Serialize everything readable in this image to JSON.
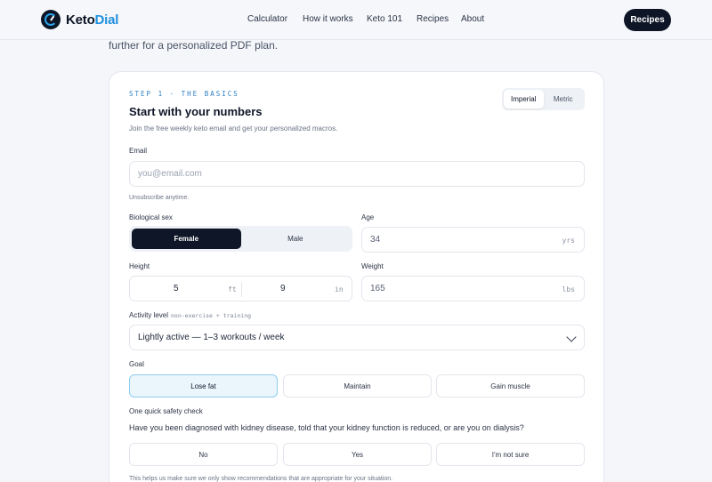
{
  "brand": {
    "name_main": "Keto",
    "name_accent": "Dial"
  },
  "nav": {
    "links": [
      "Calculator",
      "How it works",
      "Keto 101",
      "Recipes",
      "About"
    ],
    "cta": "Recipes"
  },
  "intro": "further for a personalized PDF plan.",
  "step": {
    "eyebrow": "STEP 1 · THE BASICS",
    "title": "Start with your numbers",
    "subtitle": "Join the free weekly keto email and get your personalized macros.",
    "units": [
      "Imperial",
      "Metric"
    ]
  },
  "form": {
    "email": {
      "label": "Email",
      "placeholder": "you@email.com",
      "hint": "Unsubscribe anytime."
    },
    "sex": {
      "label": "Biological sex",
      "options": [
        "Female",
        "Male"
      ]
    },
    "age": {
      "label": "Age",
      "value": "34",
      "unit": "yrs"
    },
    "height": {
      "label": "Height",
      "feet": "5",
      "feet_unit": "ft",
      "inches": "9",
      "inches_unit": "in"
    },
    "weight": {
      "label": "Weight",
      "value": "165",
      "unit": "lbs"
    },
    "activity": {
      "label": "Activity level",
      "note": "non-exercise + training",
      "value": "Lightly active — 1–3 workouts / week"
    },
    "goal": {
      "label": "Goal",
      "options": [
        "Lose fat",
        "Maintain",
        "Gain muscle"
      ]
    },
    "safety": {
      "label": "One quick safety check",
      "question": "Have you been diagnosed with kidney disease, told that your kidney function is reduced, or are you on dialysis?",
      "options": [
        "No",
        "Yes",
        "I'm not sure"
      ],
      "hint": "This helps us make sure we only show recommendations that are appropriate for your situation."
    }
  }
}
